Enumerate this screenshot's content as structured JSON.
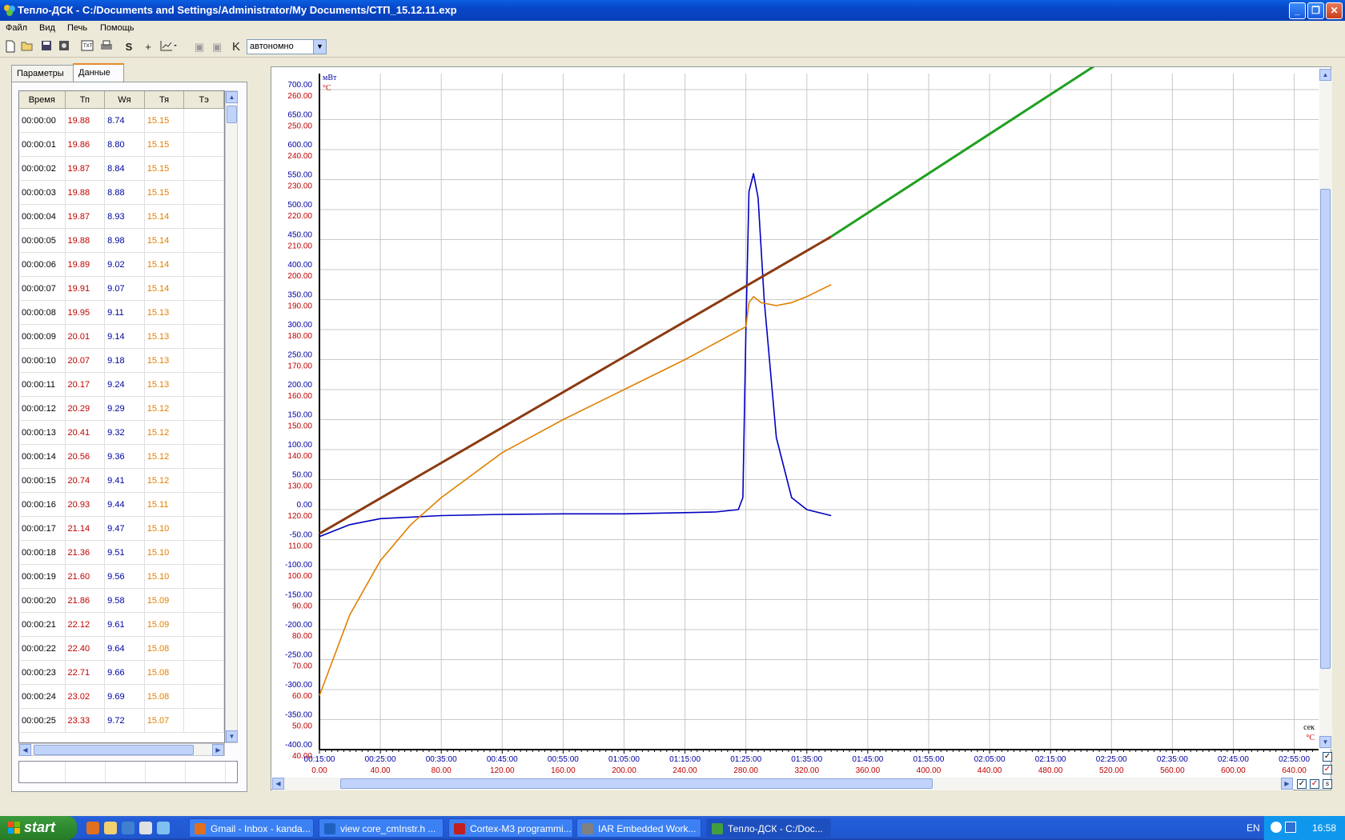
{
  "window": {
    "title": "Тепло-ДСК - C:/Documents and Settings/Administrator/My Documents/СТП_15.12.11.exp",
    "minimize": "_",
    "restore": "❐",
    "close": "✕"
  },
  "menu": [
    "Файл",
    "Вид",
    "Печь",
    "Помощь"
  ],
  "toolbar": {
    "mode_select": "автономно",
    "icons": [
      "new-icon",
      "open-icon",
      "save-icon",
      "settings-icon",
      "export-txt-icon",
      "print-icon",
      "s-icon",
      "crosshair-icon",
      "chart-options-icon",
      "camera-icon",
      "camera2-icon",
      "k-icon"
    ]
  },
  "tabs": [
    {
      "label": "Параметры",
      "active": false
    },
    {
      "label": "Данные",
      "active": true
    }
  ],
  "table": {
    "columns": [
      "Время",
      "Тп",
      "Wя",
      "Тя",
      "Тэ"
    ],
    "rows": [
      [
        "00:00:00",
        "19.88",
        "8.74",
        "15.15",
        ""
      ],
      [
        "00:00:01",
        "19.86",
        "8.80",
        "15.15",
        ""
      ],
      [
        "00:00:02",
        "19.87",
        "8.84",
        "15.15",
        ""
      ],
      [
        "00:00:03",
        "19.88",
        "8.88",
        "15.15",
        ""
      ],
      [
        "00:00:04",
        "19.87",
        "8.93",
        "15.14",
        ""
      ],
      [
        "00:00:05",
        "19.88",
        "8.98",
        "15.14",
        ""
      ],
      [
        "00:00:06",
        "19.89",
        "9.02",
        "15.14",
        ""
      ],
      [
        "00:00:07",
        "19.91",
        "9.07",
        "15.14",
        ""
      ],
      [
        "00:00:08",
        "19.95",
        "9.11",
        "15.13",
        ""
      ],
      [
        "00:00:09",
        "20.01",
        "9.14",
        "15.13",
        ""
      ],
      [
        "00:00:10",
        "20.07",
        "9.18",
        "15.13",
        ""
      ],
      [
        "00:00:11",
        "20.17",
        "9.24",
        "15.13",
        ""
      ],
      [
        "00:00:12",
        "20.29",
        "9.29",
        "15.12",
        ""
      ],
      [
        "00:00:13",
        "20.41",
        "9.32",
        "15.12",
        ""
      ],
      [
        "00:00:14",
        "20.56",
        "9.36",
        "15.12",
        ""
      ],
      [
        "00:00:15",
        "20.74",
        "9.41",
        "15.12",
        ""
      ],
      [
        "00:00:16",
        "20.93",
        "9.44",
        "15.11",
        ""
      ],
      [
        "00:00:17",
        "21.14",
        "9.47",
        "15.10",
        ""
      ],
      [
        "00:00:18",
        "21.36",
        "9.51",
        "15.10",
        ""
      ],
      [
        "00:00:19",
        "21.60",
        "9.56",
        "15.10",
        ""
      ],
      [
        "00:00:20",
        "21.86",
        "9.58",
        "15.09",
        ""
      ],
      [
        "00:00:21",
        "22.12",
        "9.61",
        "15.09",
        ""
      ],
      [
        "00:00:22",
        "22.40",
        "9.64",
        "15.08",
        ""
      ],
      [
        "00:00:23",
        "22.71",
        "9.66",
        "15.08",
        ""
      ],
      [
        "00:00:24",
        "23.02",
        "9.69",
        "15.08",
        ""
      ],
      [
        "00:00:25",
        "23.33",
        "9.72",
        "15.07",
        ""
      ]
    ],
    "column_colors": [
      "#000000",
      "#C00000",
      "#0000A0",
      "#E08000",
      "#000000"
    ]
  },
  "chart_data": {
    "type": "line",
    "left_axis_units": [
      "мВт",
      "°C"
    ],
    "y_power_ticks": [
      "700.00",
      "650.00",
      "600.00",
      "550.00",
      "500.00",
      "450.00",
      "400.00",
      "350.00",
      "300.00",
      "250.00",
      "200.00",
      "150.00",
      "100.00",
      "50.00",
      "0.00",
      "-50.00",
      "-100.00",
      "-150.00",
      "-200.00",
      "-250.00",
      "-300.00",
      "-350.00",
      "-400.00"
    ],
    "y_temp_ticks": [
      "260.00",
      "250.00",
      "240.00",
      "230.00",
      "220.00",
      "210.00",
      "200.00",
      "190.00",
      "180.00",
      "170.00",
      "160.00",
      "150.00",
      "140.00",
      "130.00",
      "120.00",
      "110.00",
      "100.00",
      "90.00",
      "80.00",
      "70.00",
      "60.00",
      "50.00",
      "40.00"
    ],
    "x_time_ticks": [
      "00:15:00",
      "00:25:00",
      "00:35:00",
      "00:45:00",
      "00:55:00",
      "01:05:00",
      "01:15:00",
      "01:25:00",
      "01:35:00",
      "01:45:00",
      "01:55:00",
      "02:05:00",
      "02:15:00",
      "02:25:00",
      "02:35:00",
      "02:45:00",
      "02:55:00"
    ],
    "x_temp_ticks": [
      "0.00",
      "40.00",
      "80.00",
      "120.00",
      "160.00",
      "200.00",
      "240.00",
      "280.00",
      "320.00",
      "360.00",
      "400.00",
      "440.00",
      "480.00",
      "520.00",
      "560.00",
      "600.00",
      "640.00"
    ],
    "x_units": [
      "сек",
      "°C"
    ],
    "ylim_power": [
      -400,
      700
    ],
    "ylim_temp": [
      40,
      260
    ],
    "xlim_temp_axis": [
      0,
      640
    ],
    "grid": true,
    "series": [
      {
        "color": "#0000C0",
        "axis": "power",
        "x": [
          0,
          20,
          40,
          80,
          120,
          160,
          200,
          240,
          260,
          275,
          278,
          280,
          282,
          285,
          288,
          292,
          300,
          310,
          320,
          336
        ],
        "y": [
          -45,
          -25,
          -15,
          -10,
          -8,
          -7,
          -7,
          -5,
          -4,
          0,
          20,
          300,
          530,
          560,
          520,
          350,
          120,
          20,
          0,
          -10
        ]
      },
      {
        "color": "#E08000",
        "axis": "temp",
        "x": [
          0,
          20,
          40,
          60,
          80,
          120,
          160,
          200,
          240,
          280,
          282,
          285,
          290,
          300,
          310,
          320,
          336
        ],
        "y": [
          58,
          85,
          103,
          115,
          124,
          139,
          150,
          160,
          170,
          181,
          189,
          191,
          189,
          188,
          189,
          191,
          195
        ]
      },
      {
        "color": "#8B3A10",
        "axis": "temp",
        "x": [
          0,
          336
        ],
        "y": [
          112,
          211
        ]
      },
      {
        "color": "#20A020",
        "axis": "temp",
        "x": [
          336,
          646
        ],
        "y": [
          211,
          313
        ]
      }
    ]
  },
  "taskbar": {
    "start": "start",
    "tasks": [
      {
        "label": "Gmail - Inbox - kanda...",
        "color": "#E07020",
        "active": false
      },
      {
        "label": "view core_cmInstr.h ...",
        "color": "#2060C0",
        "active": false
      },
      {
        "label": "Cortex-M3 programmi...",
        "color": "#C02020",
        "active": false
      },
      {
        "label": "IAR Embedded Work...",
        "color": "#808080",
        "active": false
      },
      {
        "label": "Тепло-ДСК - C:/Doc...",
        "color": "#40A040",
        "active": true
      }
    ],
    "lang": "EN",
    "clock": "16:58"
  }
}
